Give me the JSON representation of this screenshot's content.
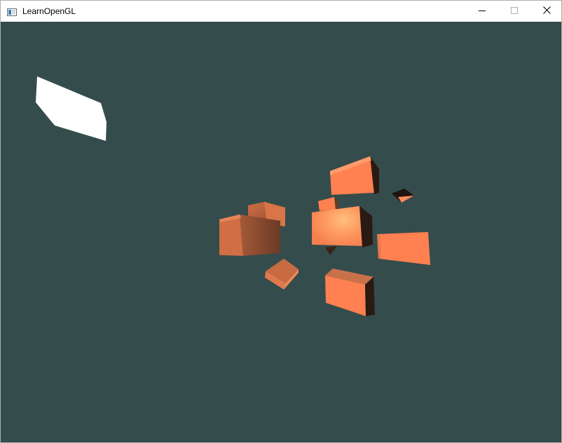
{
  "window": {
    "title": "LearnOpenGL",
    "app_icon": "window-app-icon",
    "controls": {
      "minimize_icon": "minimize-icon",
      "maximize_icon": "maximize-icon",
      "close_icon": "close-icon"
    }
  },
  "scene": {
    "clear_color": "#354c4c",
    "light_color": "#ffffff",
    "object_color": "#ff8050",
    "light_source_count": 1,
    "cube_count": 10
  }
}
